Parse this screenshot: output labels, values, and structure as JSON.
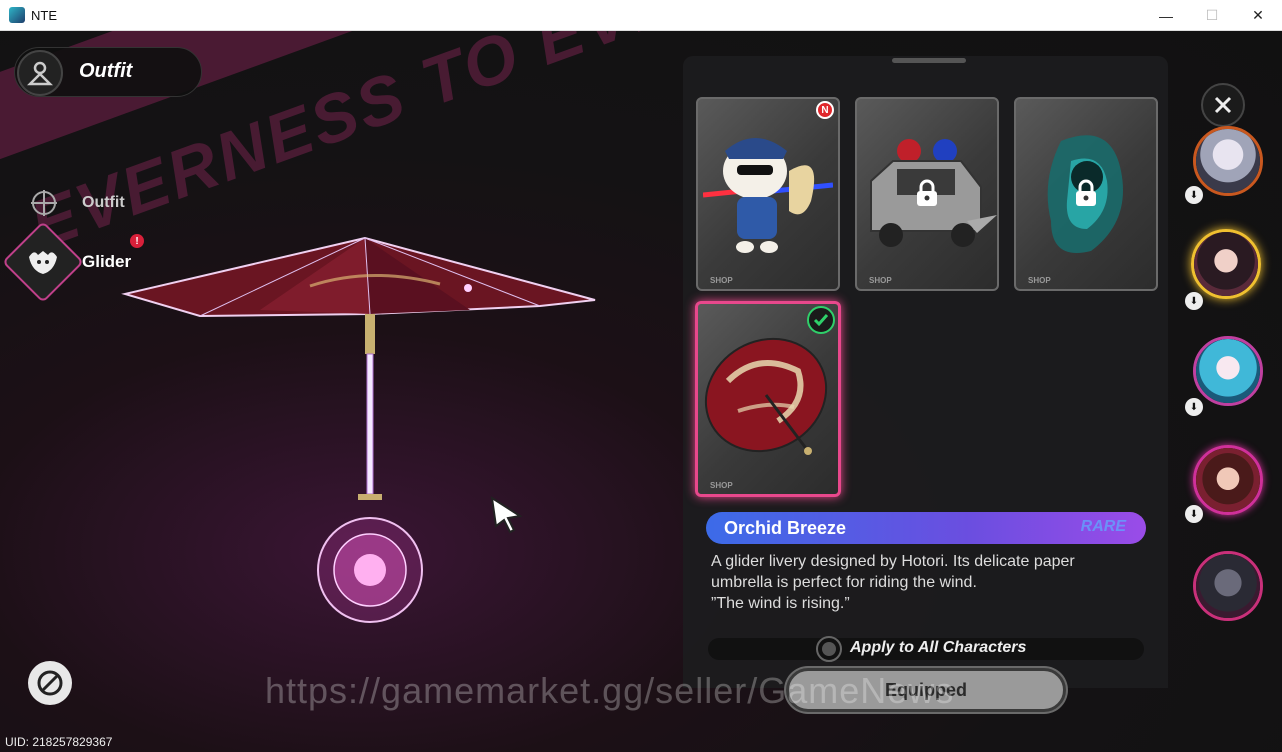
{
  "window": {
    "title": "NTE",
    "minimize": "—",
    "maximize": "☐",
    "close": "✕"
  },
  "header": {
    "title": "Outfit"
  },
  "background": {
    "banner_text": "EVERNESS TO EVERNESS"
  },
  "sidebar": {
    "items": [
      {
        "label": "Outfit",
        "icon": "crosshair-icon"
      },
      {
        "label": "Glider",
        "icon": "glider-icon",
        "alert": "!"
      }
    ]
  },
  "cards": [
    {
      "name": "police-mascot-glider",
      "shop": "SHOP",
      "locked": false,
      "new_badge": "N",
      "selected": false
    },
    {
      "name": "police-car-glider",
      "shop": "SHOP",
      "locked": true,
      "selected": false
    },
    {
      "name": "spirit-glider",
      "shop": "SHOP",
      "locked": true,
      "selected": false
    },
    {
      "name": "orchid-umbrella-glider",
      "shop": "SHOP",
      "locked": false,
      "selected": true,
      "equipped": true
    }
  ],
  "detail": {
    "name": "Orchid Breeze",
    "tier": "RARE",
    "desc_line1": "A glider livery designed by Hotori. Its delicate paper",
    "desc_line2": "umbrella is perfect for riding the wind.",
    "desc_line3": "”The wind is rising.”"
  },
  "apply_all": {
    "label": "Apply to All Characters",
    "checked": false
  },
  "equip_button": {
    "label": "Equipped"
  },
  "watermark": "https://gamemarket.gg/seller/GameNews",
  "uid": "UID: 218257829367",
  "characters": [
    {
      "name": "character-1",
      "ring": "#c9581f"
    },
    {
      "name": "character-2",
      "ring": "#f0c030"
    },
    {
      "name": "character-3",
      "ring": "#c040a0"
    },
    {
      "name": "character-4",
      "ring": "#d0309a"
    },
    {
      "name": "character-5",
      "ring": "#c9307a"
    }
  ],
  "colors": {
    "accent_pink": "#e8488c",
    "name_bar_start": "#3c6be8",
    "name_bar_end": "#9a4ce8",
    "equipped_check": "#2fd06a"
  }
}
